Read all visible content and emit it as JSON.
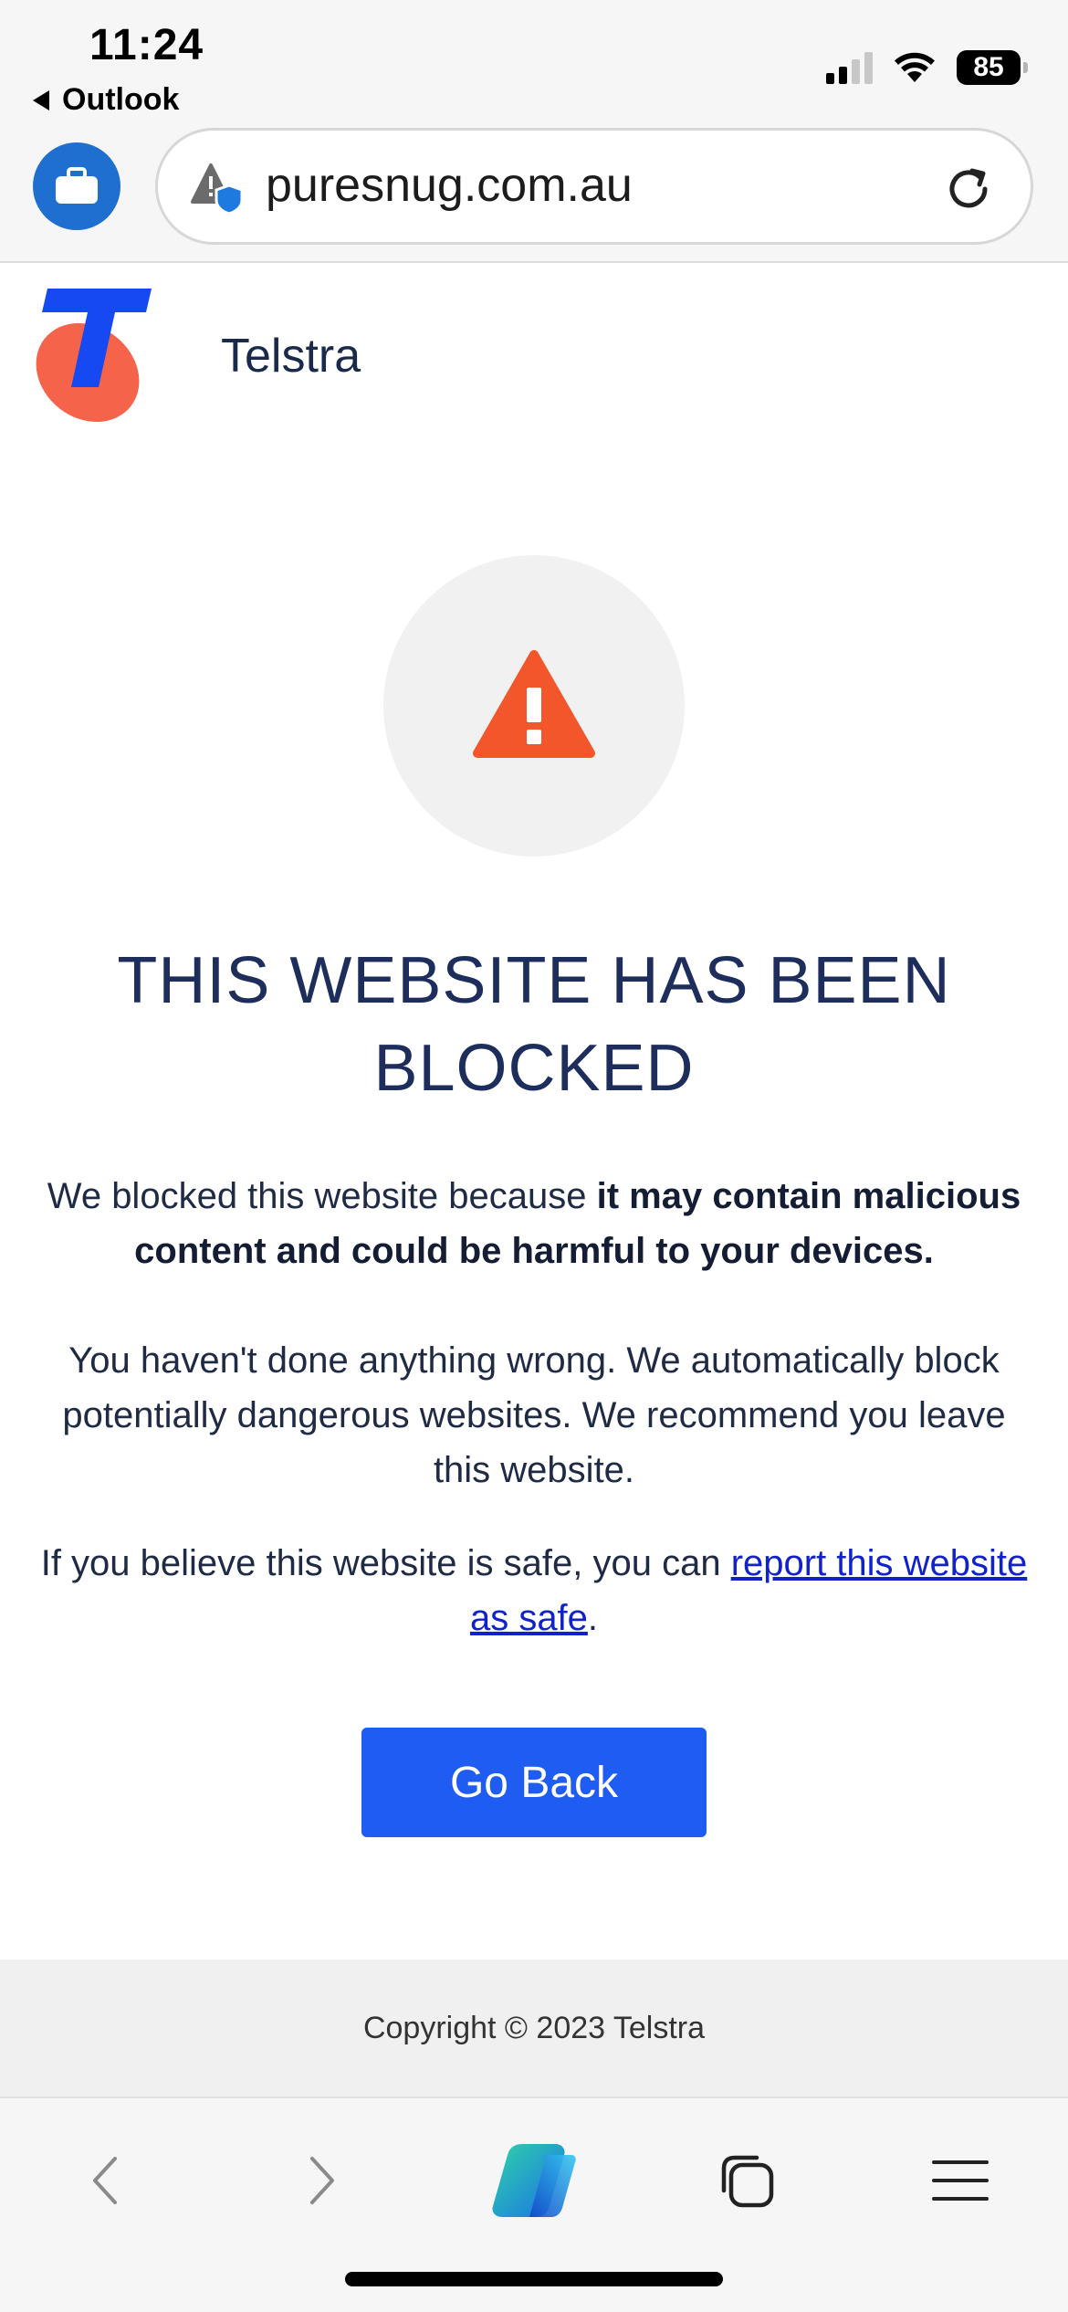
{
  "status_bar": {
    "time": "11:24",
    "back_label": "Outlook",
    "battery": "85"
  },
  "browser": {
    "url": "puresnug.com.au",
    "icons": [
      "briefcase-icon",
      "warning-shield-icon",
      "reload-icon"
    ]
  },
  "page": {
    "brand_name": "Telstra",
    "heading": "THIS WEBSITE HAS BEEN BLOCKED",
    "p1_normal": "We blocked this website because ",
    "p1_bold": "it may contain malicious content and could be harmful to your devices.",
    "p2": "You haven't done anything wrong. We automatically block potentially dangerous websites. We recommend you leave this website.",
    "p3_prefix": "If you believe this website is safe, you can ",
    "p3_link": "report this website as safe",
    "p3_suffix": ".",
    "button_label": "Go Back",
    "footer": "Copyright © 2023 Telstra"
  },
  "colors": {
    "brand_blue": "#1f5cf2",
    "logo_red": "#f4634a",
    "alert_orange": "#f4562c",
    "heading_navy": "#1d2d5c"
  },
  "toolbar": {
    "icons": [
      "back-arrow-icon",
      "forward-arrow-icon",
      "copilot-icon",
      "tabs-icon",
      "menu-icon"
    ]
  }
}
